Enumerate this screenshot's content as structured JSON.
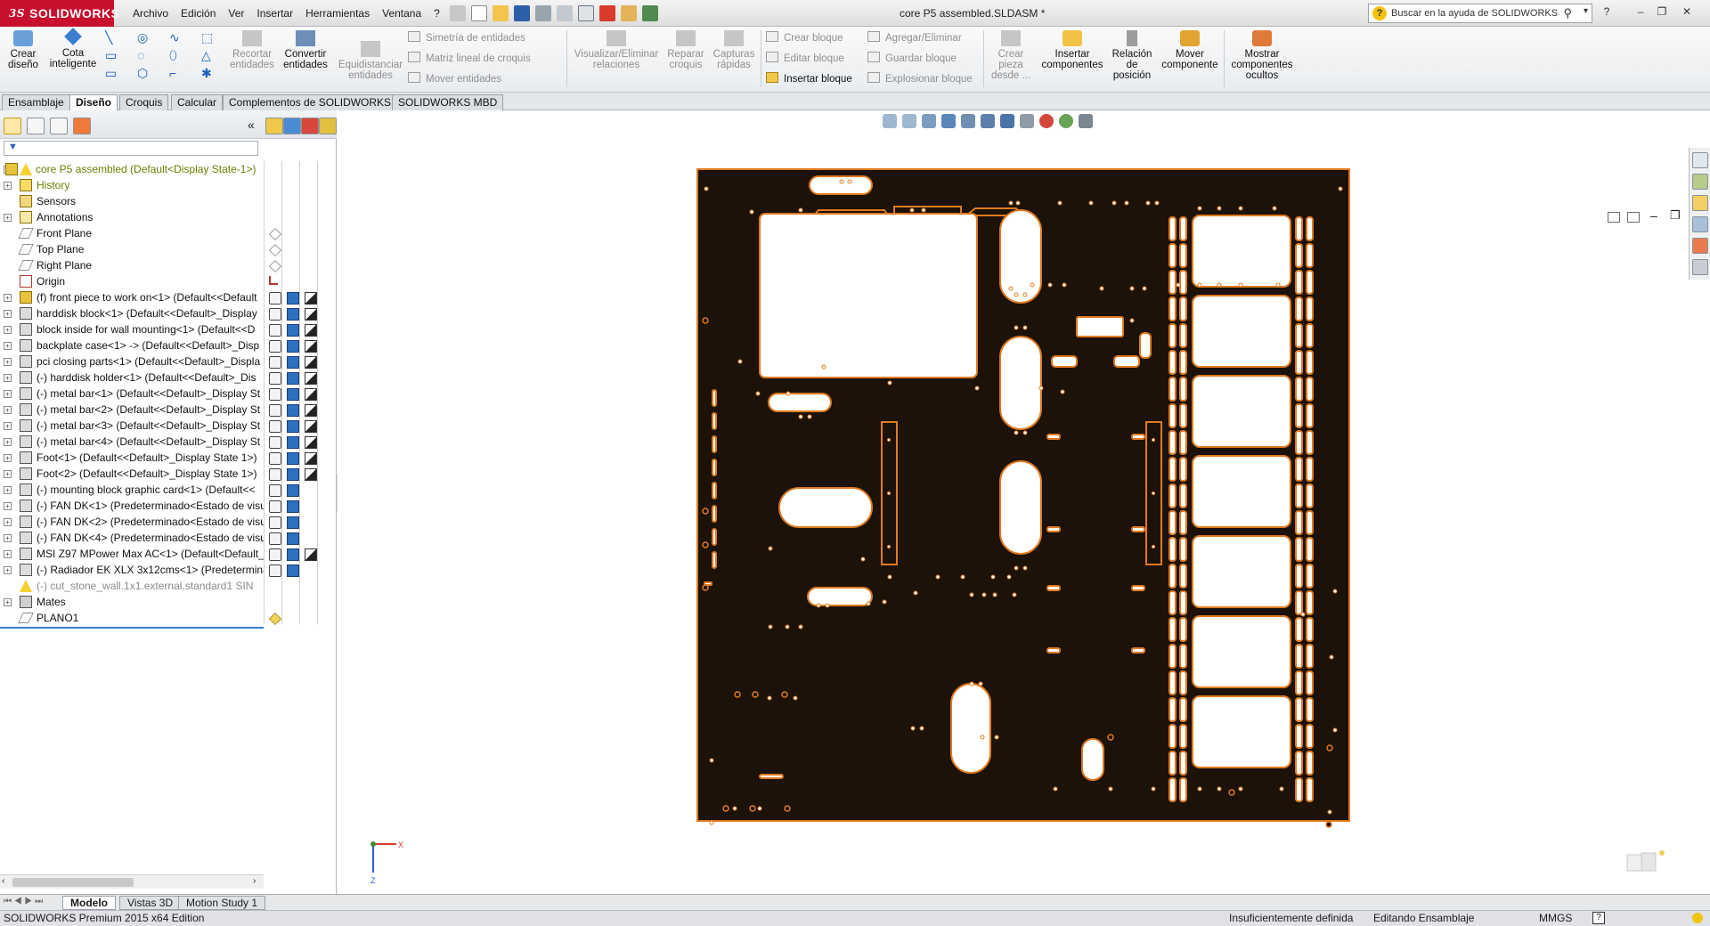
{
  "app": {
    "brand": "SOLIDWORKS",
    "document_title": "core P5 assembled.SLDASM *",
    "help_search_placeholder": "Buscar en la ayuda de SOLIDWORKS"
  },
  "menu": [
    "Archivo",
    "Edición",
    "Ver",
    "Insertar",
    "Herramientas",
    "Ventana",
    "?"
  ],
  "toolbar": {
    "crear_diseno": "Crear diseño",
    "cota_inteligente": "Cota inteligente",
    "recortar": "Recortar entidades",
    "convertir": "Convertir entidades",
    "equidistanciar": "Equidistanciar entidades",
    "simetria": "Simetría de entidades",
    "matriz": "Matriz lineal de croquis",
    "mover_entidades": "Mover entidades",
    "visualizar_relaciones": "Visualizar/Eliminar relaciones",
    "reparar_croquis": "Reparar croquis",
    "capturas_rapidas": "Capturas rápidas",
    "crear_bloque": "Crear bloque",
    "editar_bloque": "Editar bloque",
    "insertar_bloque": "Insertar bloque",
    "agregar_eliminar": "Agregar/Eliminar",
    "guardar_bloque": "Guardar bloque",
    "explosionar_bloque": "Explosionar bloque",
    "crear_pieza": "Crear pieza desde ...",
    "insertar_componentes": "Insertar componentes",
    "relacion_posicion": "Relación de posición",
    "mover_componente": "Mover componente",
    "mostrar_ocultos": "Mostrar componentes ocultos"
  },
  "command_tabs": [
    "Ensamblaje",
    "Diseño",
    "Croquis",
    "Calcular",
    "Complementos de SOLIDWORKS",
    "SOLIDWORKS MBD"
  ],
  "active_command_tab": "Diseño",
  "feature_tree": {
    "root": "core P5 assembled  (Default<Display State-1>)",
    "items": [
      {
        "label": "History",
        "expand": "+"
      },
      {
        "label": "Sensors",
        "expand": ""
      },
      {
        "label": "Annotations",
        "expand": "+"
      },
      {
        "label": "Front Plane",
        "expand": ""
      },
      {
        "label": "Top Plane",
        "expand": ""
      },
      {
        "label": "Right Plane",
        "expand": ""
      },
      {
        "label": "Origin",
        "expand": ""
      },
      {
        "label": "(f) front piece to work on<1> (Default<<Default",
        "expand": "+"
      },
      {
        "label": "harddisk block<1> (Default<<Default>_Display",
        "expand": "+"
      },
      {
        "label": "block inside for wall mounting<1> (Default<<D",
        "expand": "+"
      },
      {
        "label": "backplate case<1> -> (Default<<Default>_Disp",
        "expand": "+"
      },
      {
        "label": "pci closing parts<1> (Default<<Default>_Displa",
        "expand": "+"
      },
      {
        "label": "(-) harddisk holder<1> (Default<<Default>_Dis",
        "expand": "+"
      },
      {
        "label": "(-) metal bar<1> (Default<<Default>_Display St",
        "expand": "+"
      },
      {
        "label": "(-) metal bar<2> (Default<<Default>_Display St",
        "expand": "+"
      },
      {
        "label": "(-) metal bar<3> (Default<<Default>_Display St",
        "expand": "+"
      },
      {
        "label": "(-) metal bar<4> (Default<<Default>_Display St",
        "expand": "+"
      },
      {
        "label": "Foot<1> (Default<<Default>_Display State 1>)",
        "expand": "+"
      },
      {
        "label": "Foot<2> (Default<<Default>_Display State 1>)",
        "expand": "+"
      },
      {
        "label": "(-) mounting block graphic card<1> (Default<<",
        "expand": "+"
      },
      {
        "label": "(-) FAN DK<1> (Predeterminado<Estado de visu",
        "expand": "+"
      },
      {
        "label": "(-) FAN DK<2> (Predeterminado<Estado de visu",
        "expand": "+"
      },
      {
        "label": "(-) FAN DK<4> (Predeterminado<Estado de visu",
        "expand": "+"
      },
      {
        "label": "MSI Z97 MPower Max AC<1> (Default<Default_",
        "expand": "+"
      },
      {
        "label": "(-) Radiador EK XLX 3x12cms<1> (Predetermina",
        "expand": "+"
      },
      {
        "label": "(-) cut_stone_wall.1x1.external.standard1 SIN",
        "expand": ""
      },
      {
        "label": "Mates",
        "expand": "+"
      },
      {
        "label": "PLANO1",
        "expand": ""
      }
    ]
  },
  "bottom_tabs": [
    "Modelo",
    "Vistas 3D",
    "Motion Study 1"
  ],
  "active_bottom_tab": "Modelo",
  "status": {
    "edition": "SOLIDWORKS Premium 2015 x64 Edition",
    "definition": "Insuficientemente definida",
    "mode": "Editando Ensamblaje",
    "units": "MMGS"
  },
  "colors": {
    "panel_fill": "#1c1208",
    "panel_edge": "#e07a1f",
    "brand_red": "#c8102e",
    "tree_yellow": "#6d7d00"
  },
  "icons": [
    "search-icon",
    "help-icon",
    "home-icon",
    "filter-icon",
    "warning-icon",
    "plane-icon",
    "origin-icon",
    "part-icon",
    "mates-icon"
  ]
}
